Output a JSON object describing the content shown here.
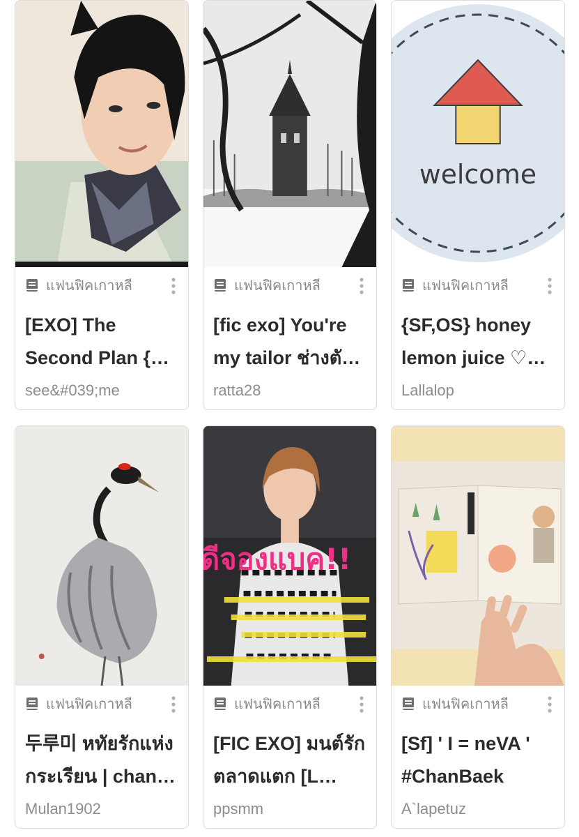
{
  "stories": [
    {
      "cover": "portrait-of-young-man",
      "category": "แฟนฟิคเกาหลี",
      "title": "[EXO] The Second Plan {…",
      "author": "see&#039;me"
    },
    {
      "cover": "gothic-castle-in-snow",
      "category": "แฟนฟิคเกาหลี",
      "title": "[fic exo] You're my tailor ช่างตั…",
      "author": "ratta28"
    },
    {
      "cover": "welcome-house-badge",
      "category": "แฟนฟิคเกาหลี",
      "title": "{SF,OS} honey lemon juice ♡…",
      "author": "Lallalop",
      "cover_text": "welcome"
    },
    {
      "cover": "crane-painting",
      "category": "แฟนฟิคเกาหลี",
      "title": "두루미 หทัยรักแห่งกระเรียน | chan…",
      "author": "Mulan1902"
    },
    {
      "cover": "boy-in-patterned-shirt",
      "category": "แฟนฟิคเกาหลี",
      "title": "[FIC EXO] มนต์รักตลาดแตก [L…",
      "author": "ppsmm",
      "cover_text": "ดีจองแบค!!"
    },
    {
      "cover": "journal-spread",
      "category": "แฟนฟิคเกาหลี",
      "title": "[Sf]  ' I = neVA ' #ChanBaek",
      "author": "A`lapetuz"
    }
  ],
  "icons": {
    "category": "book-icon",
    "menu": "more-vertical-icon"
  }
}
